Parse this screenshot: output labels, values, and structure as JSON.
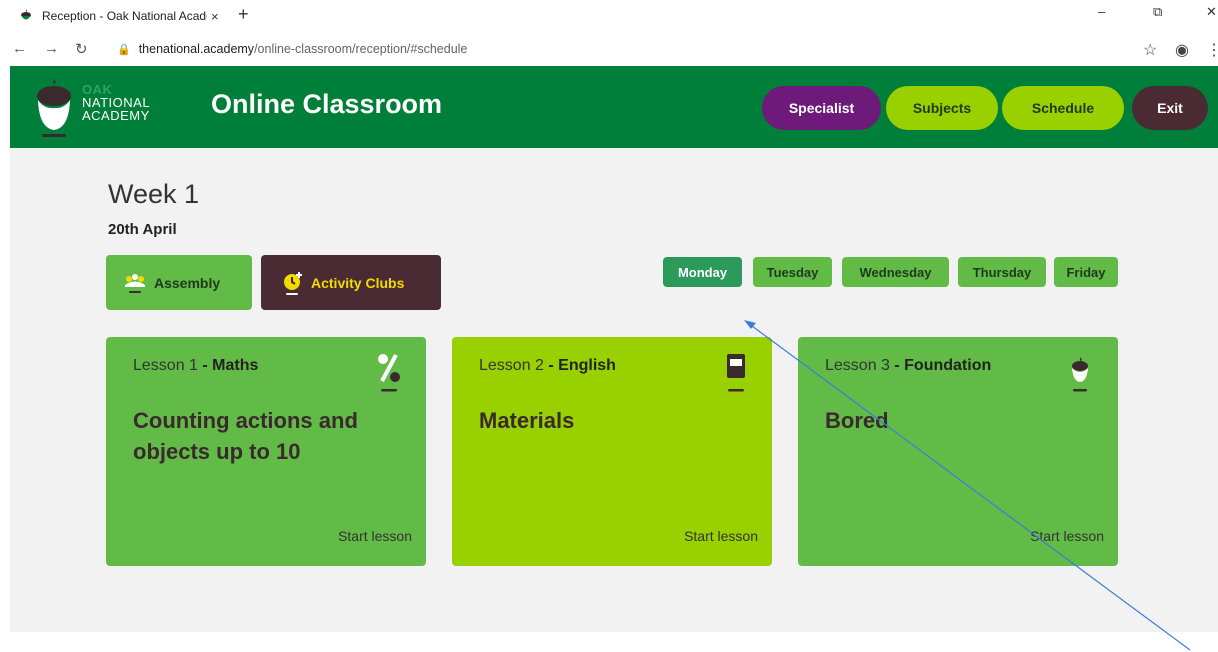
{
  "browser": {
    "tab_title": "Reception - Oak National Acader",
    "tab_close": "×",
    "new_tab": "+",
    "url_host": "thenational.academy",
    "url_path": "/online-classroom/reception/#schedule"
  },
  "header": {
    "logo_line1": "OAK",
    "logo_line2": "NATIONAL",
    "logo_line3": "ACADEMY",
    "title": "Online Classroom",
    "nav": {
      "specialist": "Specialist",
      "subjects": "Subjects",
      "schedule": "Schedule",
      "exit": "Exit"
    }
  },
  "schedule": {
    "week": "Week 1",
    "date": "20th April",
    "assembly": "Assembly",
    "activity_clubs": "Activity Clubs",
    "days": [
      "Monday",
      "Tuesday",
      "Wednesday",
      "Thursday",
      "Friday"
    ],
    "active_day": "Monday"
  },
  "lessons": [
    {
      "number": "Lesson 1",
      "subject": " - Maths",
      "title": "Counting actions and objects up to 10",
      "action": "Start lesson"
    },
    {
      "number": "Lesson 2",
      "subject": " - English",
      "title": "Materials",
      "action": "Start lesson"
    },
    {
      "number": "Lesson 3",
      "subject": " - Foundation",
      "title": "Bored",
      "action": "Start lesson"
    }
  ],
  "colors": {
    "header_green": "#007f3a",
    "lesson_green": "#62bb46",
    "lime": "#99d000",
    "purple": "#6e1a7a",
    "plum": "#4a2b33"
  }
}
